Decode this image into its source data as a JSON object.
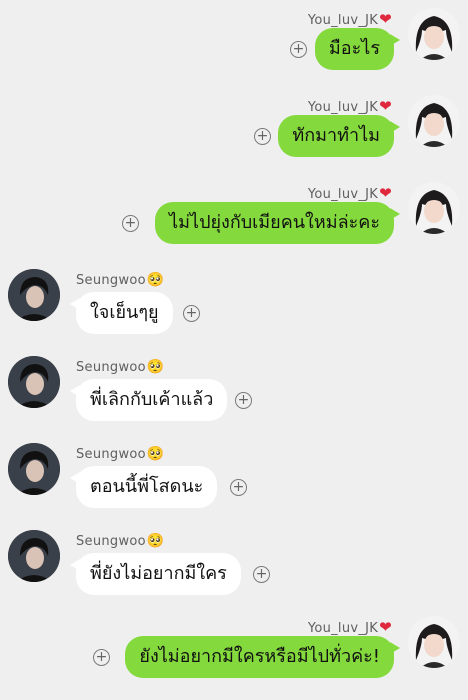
{
  "messages": [
    {
      "side": "right",
      "sender": "You_luv_JK",
      "text": "มือะไร"
    },
    {
      "side": "right",
      "sender": "You_luv_JK",
      "text": "ทักมาทำไม"
    },
    {
      "side": "right",
      "sender": "You_luv_JK",
      "text": "ไม่ไปยุ่งกับเมียคนใหม่ล่ะคะ"
    },
    {
      "side": "left",
      "sender": "Seungwoo",
      "text": "ใจเย็นๆยู"
    },
    {
      "side": "left",
      "sender": "Seungwoo",
      "text": "พี่เลิกกับเค้าแล้ว"
    },
    {
      "side": "left",
      "sender": "Seungwoo",
      "text": "ตอนนี้พี่โสดนะ"
    },
    {
      "side": "left",
      "sender": "Seungwoo",
      "text": "พี่ยังไม่อยากมีใคร"
    },
    {
      "side": "right",
      "sender": "You_luv_JK",
      "text": "ยังไม่อยากมีใครหรือมีไปทั่วค่ะ!"
    }
  ],
  "icons": {
    "heart": "❤",
    "pleading_face": "🥺",
    "add": "+"
  },
  "colors": {
    "background": "#efefef",
    "outgoing_bubble": "#84d93d",
    "incoming_bubble": "#ffffff"
  }
}
